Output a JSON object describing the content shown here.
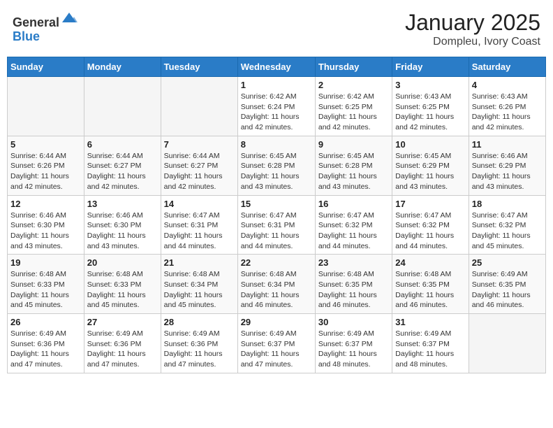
{
  "header": {
    "logo_general": "General",
    "logo_blue": "Blue",
    "title": "January 2025",
    "subtitle": "Dompleu, Ivory Coast"
  },
  "weekdays": [
    "Sunday",
    "Monday",
    "Tuesday",
    "Wednesday",
    "Thursday",
    "Friday",
    "Saturday"
  ],
  "weeks": [
    [
      {
        "day": "",
        "sunrise": "",
        "sunset": "",
        "daylight": ""
      },
      {
        "day": "",
        "sunrise": "",
        "sunset": "",
        "daylight": ""
      },
      {
        "day": "",
        "sunrise": "",
        "sunset": "",
        "daylight": ""
      },
      {
        "day": "1",
        "sunrise": "6:42 AM",
        "sunset": "6:24 PM",
        "daylight": "11 hours and 42 minutes."
      },
      {
        "day": "2",
        "sunrise": "6:42 AM",
        "sunset": "6:25 PM",
        "daylight": "11 hours and 42 minutes."
      },
      {
        "day": "3",
        "sunrise": "6:43 AM",
        "sunset": "6:25 PM",
        "daylight": "11 hours and 42 minutes."
      },
      {
        "day": "4",
        "sunrise": "6:43 AM",
        "sunset": "6:26 PM",
        "daylight": "11 hours and 42 minutes."
      }
    ],
    [
      {
        "day": "5",
        "sunrise": "6:44 AM",
        "sunset": "6:26 PM",
        "daylight": "11 hours and 42 minutes."
      },
      {
        "day": "6",
        "sunrise": "6:44 AM",
        "sunset": "6:27 PM",
        "daylight": "11 hours and 42 minutes."
      },
      {
        "day": "7",
        "sunrise": "6:44 AM",
        "sunset": "6:27 PM",
        "daylight": "11 hours and 42 minutes."
      },
      {
        "day": "8",
        "sunrise": "6:45 AM",
        "sunset": "6:28 PM",
        "daylight": "11 hours and 43 minutes."
      },
      {
        "day": "9",
        "sunrise": "6:45 AM",
        "sunset": "6:28 PM",
        "daylight": "11 hours and 43 minutes."
      },
      {
        "day": "10",
        "sunrise": "6:45 AM",
        "sunset": "6:29 PM",
        "daylight": "11 hours and 43 minutes."
      },
      {
        "day": "11",
        "sunrise": "6:46 AM",
        "sunset": "6:29 PM",
        "daylight": "11 hours and 43 minutes."
      }
    ],
    [
      {
        "day": "12",
        "sunrise": "6:46 AM",
        "sunset": "6:30 PM",
        "daylight": "11 hours and 43 minutes."
      },
      {
        "day": "13",
        "sunrise": "6:46 AM",
        "sunset": "6:30 PM",
        "daylight": "11 hours and 43 minutes."
      },
      {
        "day": "14",
        "sunrise": "6:47 AM",
        "sunset": "6:31 PM",
        "daylight": "11 hours and 44 minutes."
      },
      {
        "day": "15",
        "sunrise": "6:47 AM",
        "sunset": "6:31 PM",
        "daylight": "11 hours and 44 minutes."
      },
      {
        "day": "16",
        "sunrise": "6:47 AM",
        "sunset": "6:32 PM",
        "daylight": "11 hours and 44 minutes."
      },
      {
        "day": "17",
        "sunrise": "6:47 AM",
        "sunset": "6:32 PM",
        "daylight": "11 hours and 44 minutes."
      },
      {
        "day": "18",
        "sunrise": "6:47 AM",
        "sunset": "6:32 PM",
        "daylight": "11 hours and 45 minutes."
      }
    ],
    [
      {
        "day": "19",
        "sunrise": "6:48 AM",
        "sunset": "6:33 PM",
        "daylight": "11 hours and 45 minutes."
      },
      {
        "day": "20",
        "sunrise": "6:48 AM",
        "sunset": "6:33 PM",
        "daylight": "11 hours and 45 minutes."
      },
      {
        "day": "21",
        "sunrise": "6:48 AM",
        "sunset": "6:34 PM",
        "daylight": "11 hours and 45 minutes."
      },
      {
        "day": "22",
        "sunrise": "6:48 AM",
        "sunset": "6:34 PM",
        "daylight": "11 hours and 46 minutes."
      },
      {
        "day": "23",
        "sunrise": "6:48 AM",
        "sunset": "6:35 PM",
        "daylight": "11 hours and 46 minutes."
      },
      {
        "day": "24",
        "sunrise": "6:48 AM",
        "sunset": "6:35 PM",
        "daylight": "11 hours and 46 minutes."
      },
      {
        "day": "25",
        "sunrise": "6:49 AM",
        "sunset": "6:35 PM",
        "daylight": "11 hours and 46 minutes."
      }
    ],
    [
      {
        "day": "26",
        "sunrise": "6:49 AM",
        "sunset": "6:36 PM",
        "daylight": "11 hours and 47 minutes."
      },
      {
        "day": "27",
        "sunrise": "6:49 AM",
        "sunset": "6:36 PM",
        "daylight": "11 hours and 47 minutes."
      },
      {
        "day": "28",
        "sunrise": "6:49 AM",
        "sunset": "6:36 PM",
        "daylight": "11 hours and 47 minutes."
      },
      {
        "day": "29",
        "sunrise": "6:49 AM",
        "sunset": "6:37 PM",
        "daylight": "11 hours and 47 minutes."
      },
      {
        "day": "30",
        "sunrise": "6:49 AM",
        "sunset": "6:37 PM",
        "daylight": "11 hours and 48 minutes."
      },
      {
        "day": "31",
        "sunrise": "6:49 AM",
        "sunset": "6:37 PM",
        "daylight": "11 hours and 48 minutes."
      },
      {
        "day": "",
        "sunrise": "",
        "sunset": "",
        "daylight": ""
      }
    ]
  ],
  "labels": {
    "sunrise": "Sunrise:",
    "sunset": "Sunset:",
    "daylight": "Daylight:"
  }
}
